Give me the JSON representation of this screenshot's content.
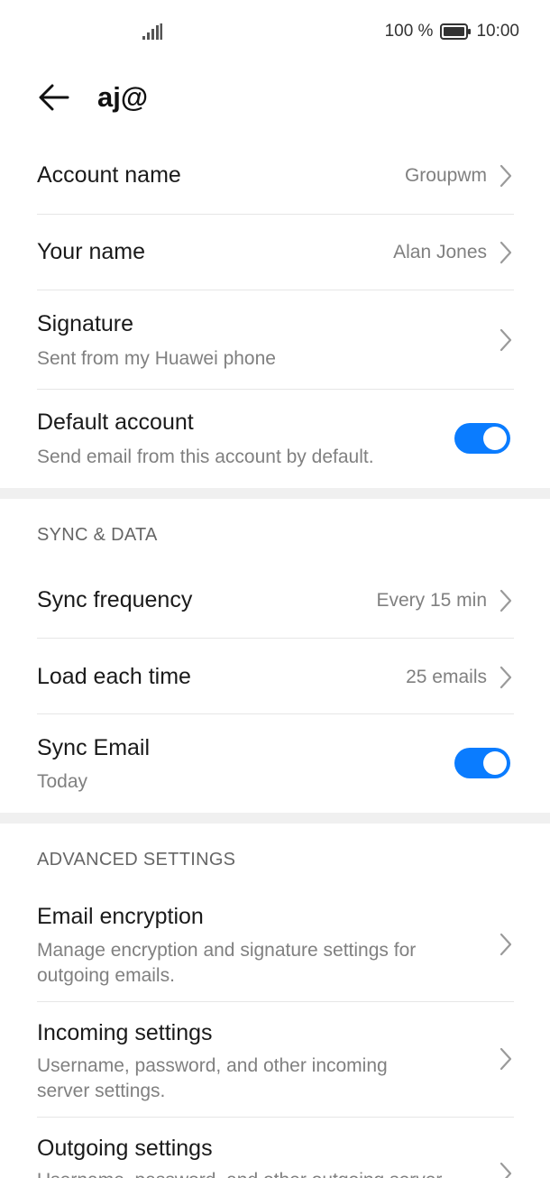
{
  "status_bar": {
    "battery_percent": "100 %",
    "time": "10:00"
  },
  "header": {
    "title": "aj@"
  },
  "account": {
    "account_name": {
      "label": "Account name",
      "value": "Groupwm"
    },
    "your_name": {
      "label": "Your name",
      "value": "Alan Jones"
    },
    "signature": {
      "label": "Signature",
      "subtitle": "Sent from my Huawei phone"
    },
    "default_account": {
      "label": "Default account",
      "subtitle": "Send email from this account by default.",
      "enabled": true
    }
  },
  "sync_data": {
    "header": "SYNC & DATA",
    "sync_frequency": {
      "label": "Sync frequency",
      "value": "Every 15 min"
    },
    "load_each_time": {
      "label": "Load each time",
      "value": "25 emails"
    },
    "sync_email": {
      "label": "Sync Email",
      "subtitle": "Today",
      "enabled": true
    }
  },
  "advanced": {
    "header": "ADVANCED SETTINGS",
    "email_encryption": {
      "label": "Email encryption",
      "subtitle_line1": "Manage encryption and signature settings for",
      "subtitle_line2": "outgoing emails."
    },
    "incoming_settings": {
      "label": "Incoming settings",
      "subtitle_line1": "Username, password, and other incoming",
      "subtitle_line2": "server settings."
    },
    "outgoing_settings": {
      "label": "Outgoing settings",
      "subtitle_line1": "Username, password, and other outgoing server"
    }
  },
  "colors": {
    "accent": "#0a7cff",
    "secondary_text": "#808080",
    "divider": "#e6e6e6",
    "section_band": "#f0f0f0"
  },
  "icons": {
    "back": "arrow-left-icon",
    "chevron": "chevron-right-icon",
    "signal": "signal-icon",
    "battery": "battery-icon"
  }
}
